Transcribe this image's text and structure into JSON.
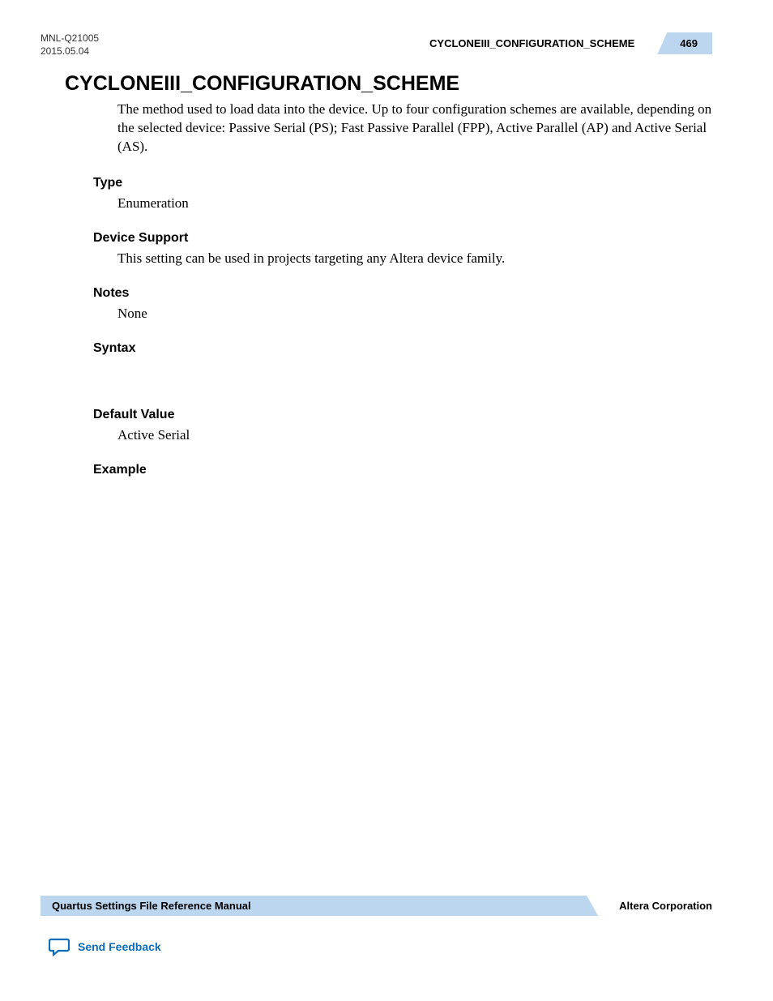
{
  "header": {
    "doc_id": "MNL-Q21005",
    "doc_date": "2015.05.04",
    "topic": "CYCLONEIII_CONFIGURATION_SCHEME",
    "page_number": "469"
  },
  "main": {
    "heading": "CYCLONEIII_CONFIGURATION_SCHEME",
    "intro": "The method used to load data into the device. Up to four configuration schemes are available, depending on the selected device: Passive Serial (PS); Fast Passive Parallel (FPP), Active Parallel (AP) and Active Serial (AS).",
    "sections": {
      "type_label": "Type",
      "type_value": "Enumeration",
      "device_support_label": "Device Support",
      "device_support_value": "This setting can be used in projects targeting any Altera device family.",
      "notes_label": "Notes",
      "notes_value": "None",
      "syntax_label": "Syntax",
      "default_value_label": "Default Value",
      "default_value_value": "Active Serial",
      "example_label": "Example"
    }
  },
  "footer": {
    "manual_title": "Quartus Settings File Reference Manual",
    "company": "Altera Corporation",
    "feedback_label": "Send Feedback"
  }
}
